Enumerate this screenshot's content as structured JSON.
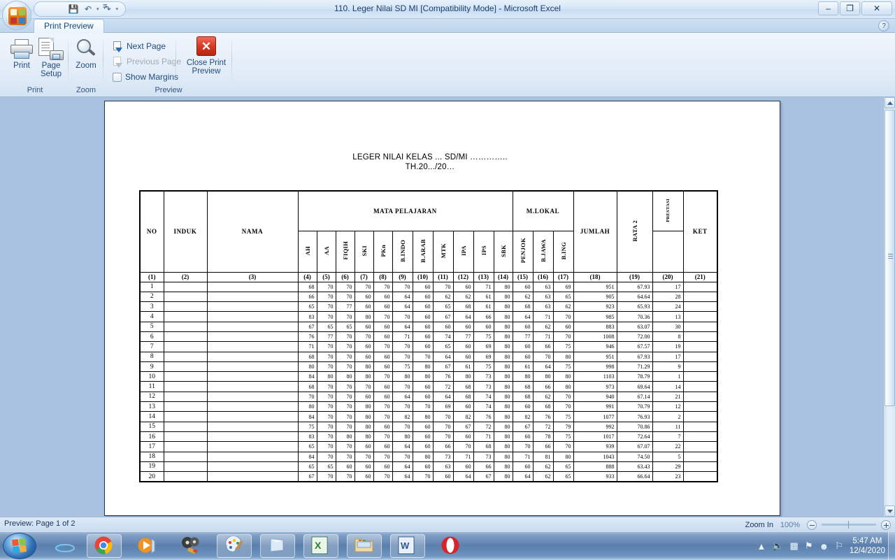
{
  "window": {
    "title": "110. Leger Nilai SD MI  [Compatibility Mode] - Microsoft Excel",
    "minimize_label": "–",
    "maximize_label": "❐",
    "close_label": "✕",
    "help_label": "?"
  },
  "quick_access": {
    "save_label": "💾",
    "undo_label": "↶",
    "redo_label": "↷",
    "caret_label": "▾",
    "more_label": "≡"
  },
  "ribbon": {
    "tab_label": "Print Preview",
    "groups": [
      {
        "name": "print",
        "label": "Print"
      },
      {
        "name": "zoom",
        "label": "Zoom"
      },
      {
        "name": "preview",
        "label": "Preview"
      }
    ],
    "print_button": "Print",
    "page_setup_button": "Page\nSetup",
    "page_setup_line1": "Page",
    "page_setup_line2": "Setup",
    "zoom_button": "Zoom",
    "next_page": "Next Page",
    "previous_page": "Previous Page",
    "show_margins": "Show Margins",
    "close_preview_line1": "Close Print",
    "close_preview_line2": "Preview",
    "close_icon_label": "✕"
  },
  "document": {
    "title_line1": "LEGER NILAI KELAS ... SD/MI …………..",
    "title_line2": "TH.20.../20…"
  },
  "table": {
    "group_headers": {
      "no": "NO",
      "induk": "INDUK",
      "nama": "NAMA",
      "mata_pelajaran": "MATA PELAJARAN",
      "m_lokal": "M.LOKAL",
      "jumlah": "JUMLAH",
      "rata2": "RATA 2",
      "prestasi": "PRESTASI",
      "ket": "KET"
    },
    "subject_headers": [
      "AH",
      "AA",
      "FIQIH",
      "SKI",
      "PKn",
      "B.INDO",
      "B.ARAB",
      "MTK",
      "IPA",
      "IPS",
      "SBK"
    ],
    "mlokal_headers": [
      "PENJOK",
      "B.JAWA",
      "B.ING"
    ],
    "number_row": [
      "(1)",
      "(2)",
      "(3)",
      "(4)",
      "(5)",
      "(6)",
      "(7)",
      "(8)",
      "(9)",
      "(10)",
      "(11)",
      "(12)",
      "(13)",
      "(14)",
      "(15)",
      "(16)",
      "(17)",
      "(18)",
      "(19)",
      "(20)",
      "(21)"
    ],
    "rows": [
      {
        "no": "1",
        "induk": "",
        "nama": "",
        "scores": [
          "68",
          "70",
          "70",
          "70",
          "70",
          "70",
          "60",
          "70",
          "60",
          "71",
          "80",
          "60",
          "63",
          "69"
        ],
        "jumlah": "951",
        "rata2": "67.93",
        "prestasi": "17",
        "ket": ""
      },
      {
        "no": "2",
        "induk": "",
        "nama": "",
        "scores": [
          "66",
          "70",
          "70",
          "60",
          "60",
          "64",
          "60",
          "62",
          "62",
          "61",
          "80",
          "62",
          "63",
          "65"
        ],
        "jumlah": "905",
        "rata2": "64.64",
        "prestasi": "28",
        "ket": ""
      },
      {
        "no": "3",
        "induk": "",
        "nama": "",
        "scores": [
          "65",
          "70",
          "77",
          "60",
          "60",
          "64",
          "60",
          "65",
          "68",
          "61",
          "80",
          "68",
          "63",
          "62"
        ],
        "jumlah": "923",
        "rata2": "65.93",
        "prestasi": "24",
        "ket": ""
      },
      {
        "no": "4",
        "induk": "",
        "nama": "",
        "scores": [
          "83",
          "70",
          "70",
          "80",
          "70",
          "70",
          "60",
          "67",
          "64",
          "66",
          "80",
          "64",
          "71",
          "70"
        ],
        "jumlah": "985",
        "rata2": "70.36",
        "prestasi": "13",
        "ket": ""
      },
      {
        "no": "5",
        "induk": "",
        "nama": "",
        "scores": [
          "67",
          "65",
          "65",
          "60",
          "60",
          "64",
          "60",
          "60",
          "60",
          "60",
          "80",
          "60",
          "62",
          "60"
        ],
        "jumlah": "883",
        "rata2": "63.07",
        "prestasi": "30",
        "ket": ""
      },
      {
        "no": "6",
        "induk": "",
        "nama": "",
        "scores": [
          "76",
          "77",
          "70",
          "70",
          "60",
          "71",
          "60",
          "74",
          "77",
          "75",
          "80",
          "77",
          "71",
          "70"
        ],
        "jumlah": "1008",
        "rata2": "72.00",
        "prestasi": "8",
        "ket": ""
      },
      {
        "no": "7",
        "induk": "",
        "nama": "",
        "scores": [
          "71",
          "70",
          "70",
          "60",
          "70",
          "70",
          "60",
          "65",
          "60",
          "69",
          "80",
          "60",
          "66",
          "75"
        ],
        "jumlah": "946",
        "rata2": "67.57",
        "prestasi": "19",
        "ket": ""
      },
      {
        "no": "8",
        "induk": "",
        "nama": "",
        "scores": [
          "68",
          "70",
          "70",
          "60",
          "60",
          "70",
          "70",
          "64",
          "60",
          "69",
          "80",
          "60",
          "70",
          "80"
        ],
        "jumlah": "951",
        "rata2": "67.93",
        "prestasi": "17",
        "ket": ""
      },
      {
        "no": "9",
        "induk": "",
        "nama": "",
        "scores": [
          "80",
          "70",
          "70",
          "80",
          "60",
          "75",
          "80",
          "67",
          "61",
          "75",
          "80",
          "61",
          "64",
          "75"
        ],
        "jumlah": "998",
        "rata2": "71.29",
        "prestasi": "9",
        "ket": ""
      },
      {
        "no": "10",
        "induk": "",
        "nama": "",
        "scores": [
          "84",
          "80",
          "80",
          "80",
          "70",
          "80",
          "80",
          "76",
          "80",
          "73",
          "80",
          "80",
          "80",
          "80"
        ],
        "jumlah": "1103",
        "rata2": "78.79",
        "prestasi": "1",
        "ket": ""
      },
      {
        "no": "11",
        "induk": "",
        "nama": "",
        "scores": [
          "68",
          "70",
          "70",
          "70",
          "60",
          "70",
          "60",
          "72",
          "68",
          "73",
          "80",
          "68",
          "66",
          "80"
        ],
        "jumlah": "973",
        "rata2": "69.64",
        "prestasi": "14",
        "ket": ""
      },
      {
        "no": "12",
        "induk": "",
        "nama": "",
        "scores": [
          "70",
          "70",
          "70",
          "60",
          "60",
          "64",
          "60",
          "64",
          "68",
          "74",
          "80",
          "68",
          "62",
          "70"
        ],
        "jumlah": "940",
        "rata2": "67.14",
        "prestasi": "21",
        "ket": ""
      },
      {
        "no": "13",
        "induk": "",
        "nama": "",
        "scores": [
          "80",
          "70",
          "70",
          "80",
          "70",
          "70",
          "70",
          "69",
          "60",
          "74",
          "80",
          "60",
          "68",
          "70"
        ],
        "jumlah": "991",
        "rata2": "70.79",
        "prestasi": "12",
        "ket": ""
      },
      {
        "no": "14",
        "induk": "",
        "nama": "",
        "scores": [
          "84",
          "70",
          "70",
          "80",
          "70",
          "82",
          "80",
          "70",
          "82",
          "76",
          "80",
          "82",
          "76",
          "75"
        ],
        "jumlah": "1077",
        "rata2": "76.93",
        "prestasi": "2",
        "ket": ""
      },
      {
        "no": "15",
        "induk": "",
        "nama": "",
        "scores": [
          "75",
          "70",
          "70",
          "80",
          "60",
          "70",
          "60",
          "70",
          "67",
          "72",
          "80",
          "67",
          "72",
          "79"
        ],
        "jumlah": "992",
        "rata2": "70.86",
        "prestasi": "11",
        "ket": ""
      },
      {
        "no": "16",
        "induk": "",
        "nama": "",
        "scores": [
          "83",
          "70",
          "80",
          "80",
          "70",
          "80",
          "60",
          "70",
          "60",
          "71",
          "80",
          "60",
          "78",
          "75"
        ],
        "jumlah": "1017",
        "rata2": "72.64",
        "prestasi": "7",
        "ket": ""
      },
      {
        "no": "17",
        "induk": "",
        "nama": "",
        "scores": [
          "65",
          "70",
          "70",
          "60",
          "60",
          "64",
          "60",
          "66",
          "70",
          "68",
          "80",
          "70",
          "66",
          "70"
        ],
        "jumlah": "939",
        "rata2": "67.07",
        "prestasi": "22",
        "ket": ""
      },
      {
        "no": "18",
        "induk": "",
        "nama": "",
        "scores": [
          "84",
          "70",
          "70",
          "70",
          "70",
          "70",
          "80",
          "73",
          "71",
          "73",
          "80",
          "71",
          "81",
          "80"
        ],
        "jumlah": "1043",
        "rata2": "74.50",
        "prestasi": "5",
        "ket": ""
      },
      {
        "no": "19",
        "induk": "",
        "nama": "",
        "scores": [
          "65",
          "65",
          "60",
          "60",
          "60",
          "64",
          "60",
          "63",
          "60",
          "66",
          "80",
          "60",
          "62",
          "65"
        ],
        "jumlah": "888",
        "rata2": "63.43",
        "prestasi": "29",
        "ket": ""
      },
      {
        "no": "20",
        "induk": "",
        "nama": "",
        "scores": [
          "67",
          "70",
          "70",
          "60",
          "70",
          "64",
          "70",
          "60",
          "64",
          "67",
          "80",
          "64",
          "62",
          "65"
        ],
        "jumlah": "933",
        "rata2": "66.64",
        "prestasi": "23",
        "ket": ""
      }
    ]
  },
  "statusbar": {
    "preview_status": "Preview: Page 1 of 2",
    "zoom_in_label": "Zoom In",
    "zoom_percent": "100%"
  },
  "taskbar": {
    "start_label": "Start",
    "items": [
      {
        "name": "internet-explorer",
        "boxed": false
      },
      {
        "name": "google-chrome",
        "boxed": true
      },
      {
        "name": "media-player",
        "boxed": false
      },
      {
        "name": "movie-maker",
        "boxed": false
      },
      {
        "name": "paint",
        "boxed": true
      },
      {
        "name": "notepad",
        "boxed": true
      },
      {
        "name": "excel",
        "boxed": true
      },
      {
        "name": "file-explorer",
        "boxed": true
      },
      {
        "name": "word",
        "boxed": true
      },
      {
        "name": "opera",
        "boxed": false
      }
    ],
    "clock_time": "5:47 AM",
    "clock_date": "12/4/2020"
  },
  "colors": {
    "accent": "#1f4b7c",
    "page_background": "#a8c2e0",
    "close_red": "#d63a22"
  }
}
